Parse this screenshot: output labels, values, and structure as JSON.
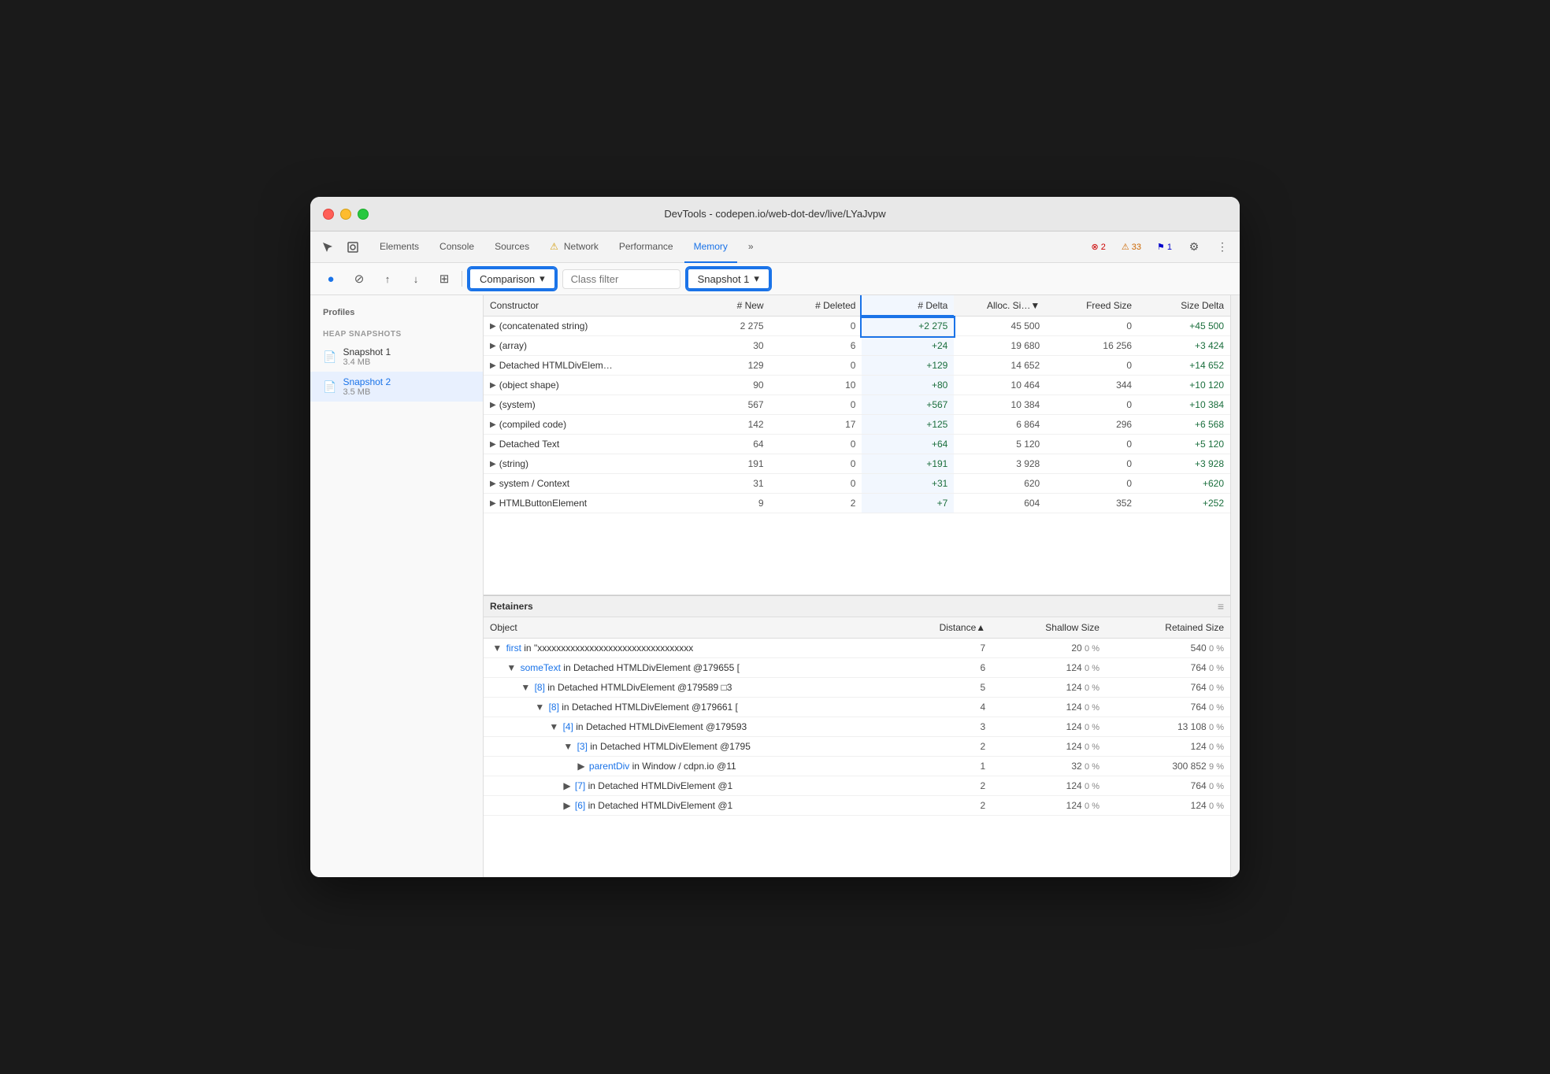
{
  "window": {
    "title": "DevTools - codepen.io/web-dot-dev/live/LYaJvpw"
  },
  "traffic_lights": {
    "red": "red",
    "yellow": "yellow",
    "green": "green"
  },
  "tabs": [
    {
      "label": "Elements",
      "active": false
    },
    {
      "label": "Console",
      "active": false
    },
    {
      "label": "Sources",
      "active": false
    },
    {
      "label": "⚠ Network",
      "active": false
    },
    {
      "label": "Performance",
      "active": false
    },
    {
      "label": "Memory",
      "active": true
    },
    {
      "label": "»",
      "active": false
    }
  ],
  "badge_error": "2",
  "badge_warning": "33",
  "badge_info": "1",
  "toolbar": {
    "record_label": "●",
    "clear_label": "⊘",
    "upload_label": "↑",
    "download_label": "↓",
    "settings_label": "⊞",
    "comparison_label": "Comparison",
    "class_filter_placeholder": "Class filter",
    "snapshot_label": "Snapshot 1"
  },
  "columns": {
    "constructor": "Constructor",
    "new": "# New",
    "deleted": "# Deleted",
    "delta": "# Delta",
    "alloc_size": "Alloc. Si…▼",
    "freed_size": "Freed Size",
    "size_delta": "Size Delta"
  },
  "rows": [
    {
      "constructor": "(concatenated string)",
      "new": "2 275",
      "deleted": "0",
      "delta": "+2 275",
      "alloc_size": "45 500",
      "freed_size": "0",
      "size_delta": "+45 500"
    },
    {
      "constructor": "(array)",
      "new": "30",
      "deleted": "6",
      "delta": "+24",
      "alloc_size": "19 680",
      "freed_size": "16 256",
      "size_delta": "+3 424"
    },
    {
      "constructor": "Detached HTMLDivElem…",
      "new": "129",
      "deleted": "0",
      "delta": "+129",
      "alloc_size": "14 652",
      "freed_size": "0",
      "size_delta": "+14 652"
    },
    {
      "constructor": "(object shape)",
      "new": "90",
      "deleted": "10",
      "delta": "+80",
      "alloc_size": "10 464",
      "freed_size": "344",
      "size_delta": "+10 120"
    },
    {
      "constructor": "(system)",
      "new": "567",
      "deleted": "0",
      "delta": "+567",
      "alloc_size": "10 384",
      "freed_size": "0",
      "size_delta": "+10 384"
    },
    {
      "constructor": "(compiled code)",
      "new": "142",
      "deleted": "17",
      "delta": "+125",
      "alloc_size": "6 864",
      "freed_size": "296",
      "size_delta": "+6 568"
    },
    {
      "constructor": "Detached Text",
      "new": "64",
      "deleted": "0",
      "delta": "+64",
      "alloc_size": "5 120",
      "freed_size": "0",
      "size_delta": "+5 120"
    },
    {
      "constructor": "(string)",
      "new": "191",
      "deleted": "0",
      "delta": "+191",
      "alloc_size": "3 928",
      "freed_size": "0",
      "size_delta": "+3 928"
    },
    {
      "constructor": "system / Context",
      "new": "31",
      "deleted": "0",
      "delta": "+31",
      "alloc_size": "620",
      "freed_size": "0",
      "size_delta": "+620"
    },
    {
      "constructor": "HTMLButtonElement",
      "new": "9",
      "deleted": "2",
      "delta": "+7",
      "alloc_size": "604",
      "freed_size": "352",
      "size_delta": "+252"
    }
  ],
  "retainers": {
    "section_label": "Retainers",
    "columns": {
      "object": "Object",
      "distance": "Distance▲",
      "shallow_size": "Shallow Size",
      "retained_size": "Retained Size"
    },
    "rows": [
      {
        "indent": 0,
        "prefix": "▼",
        "link": "first",
        "text": " in \"xxxxxxxxxxxxxxxxxxxxxxxxxxxxxxxxx",
        "distance": "7",
        "shallow": "20",
        "shallow_pct": "0 %",
        "retained": "540",
        "retained_pct": "0 %"
      },
      {
        "indent": 1,
        "prefix": "▼",
        "link": "someText",
        "text": " in Detached HTMLDivElement @179655 [",
        "distance": "6",
        "shallow": "124",
        "shallow_pct": "0 %",
        "retained": "764",
        "retained_pct": "0 %"
      },
      {
        "indent": 2,
        "prefix": "▼",
        "link": "[8]",
        "text": " in Detached HTMLDivElement @179589 □3",
        "distance": "5",
        "shallow": "124",
        "shallow_pct": "0 %",
        "retained": "764",
        "retained_pct": "0 %"
      },
      {
        "indent": 3,
        "prefix": "▼",
        "link": "[8]",
        "text": " in Detached HTMLDivElement @179661 [",
        "distance": "4",
        "shallow": "124",
        "shallow_pct": "0 %",
        "retained": "764",
        "retained_pct": "0 %"
      },
      {
        "indent": 4,
        "prefix": "▼",
        "link": "[4]",
        "text": " in Detached HTMLDivElement @179593",
        "distance": "3",
        "shallow": "124",
        "shallow_pct": "0 %",
        "retained": "13 108",
        "retained_pct": "0 %"
      },
      {
        "indent": 5,
        "prefix": "▼",
        "link": "[3]",
        "text": " in Detached HTMLDivElement @1795",
        "distance": "2",
        "shallow": "124",
        "shallow_pct": "0 %",
        "retained": "124",
        "retained_pct": "0 %"
      },
      {
        "indent": 6,
        "prefix": "▶",
        "link": "parentDiv",
        "text": " in Window / cdpn.io @11",
        "distance": "1",
        "shallow": "32",
        "shallow_pct": "0 %",
        "retained": "300 852",
        "retained_pct": "9 %"
      },
      {
        "indent": 5,
        "prefix": "▶",
        "link": "[7]",
        "text": " in Detached HTMLDivElement @1",
        "distance": "2",
        "shallow": "124",
        "shallow_pct": "0 %",
        "retained": "764",
        "retained_pct": "0 %"
      },
      {
        "indent": 5,
        "prefix": "▶",
        "link": "[6]",
        "text": " in Detached HTMLDivElement @1",
        "distance": "2",
        "shallow": "124",
        "shallow_pct": "0 %",
        "retained": "124",
        "retained_pct": "0 %"
      }
    ]
  },
  "sidebar": {
    "title": "Profiles",
    "section": "HEAP SNAPSHOTS",
    "items": [
      {
        "name": "Snapshot 1",
        "size": "3.4 MB",
        "active": false
      },
      {
        "name": "Snapshot 2",
        "size": "3.5 MB",
        "active": true
      }
    ]
  }
}
